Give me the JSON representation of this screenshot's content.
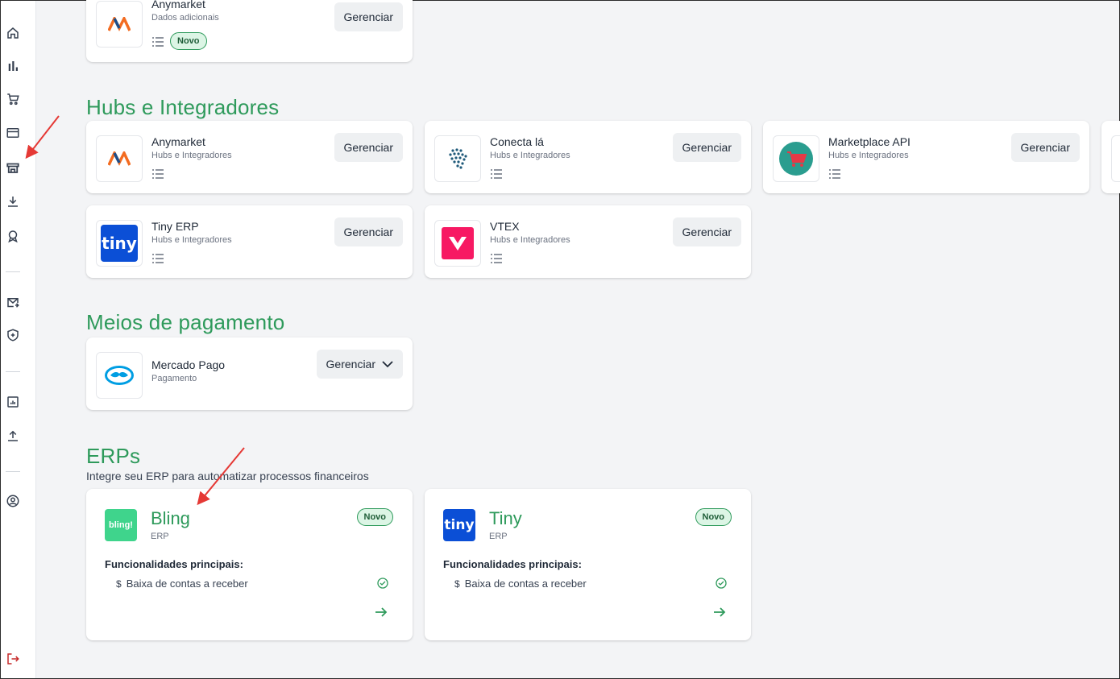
{
  "sidebar": {
    "items": [
      {
        "icon": "home-icon"
      },
      {
        "icon": "bar-chart-icon"
      },
      {
        "icon": "cart-icon"
      },
      {
        "icon": "card-icon"
      },
      {
        "icon": "store-icon"
      },
      {
        "icon": "download-icon"
      },
      {
        "icon": "award-icon"
      },
      {
        "icon": "mail-forward-icon"
      },
      {
        "icon": "shield-plus-icon"
      },
      {
        "icon": "report-icon"
      },
      {
        "icon": "upload-icon"
      },
      {
        "icon": "user-circle-icon"
      },
      {
        "icon": "logout-icon"
      }
    ]
  },
  "top_card": {
    "name": "Anymarket",
    "category": "Dados adicionais",
    "badge": "Novo",
    "button": "Gerenciar"
  },
  "hubs": {
    "title": "Hubs e Integradores",
    "cards": [
      {
        "name": "Anymarket",
        "category": "Hubs e Integradores",
        "button": "Gerenciar"
      },
      {
        "name": "Conecta lá",
        "category": "Hubs e Integradores",
        "button": "Gerenciar"
      },
      {
        "name": "Marketplace API",
        "category": "Hubs e Integradores",
        "button": "Gerenciar"
      },
      {
        "name": "Tiny ERP",
        "category": "Hubs e Integradores",
        "button": "Gerenciar"
      },
      {
        "name": "VTEX",
        "category": "Hubs e Integradores",
        "button": "Gerenciar"
      }
    ]
  },
  "payments": {
    "title": "Meios de pagamento",
    "cards": [
      {
        "name": "Mercado Pago",
        "category": "Pagamento",
        "button": "Gerenciar"
      }
    ]
  },
  "erps": {
    "title": "ERPs",
    "subtitle": "Integre seu ERP para automatizar processos financeiros",
    "cards": [
      {
        "name": "Bling",
        "category": "ERP",
        "badge": "Novo",
        "func_title": "Funcionalidades principais:",
        "feature_symbol": "$",
        "feature": "Baixa de contas a receber",
        "logo_text": "bling!"
      },
      {
        "name": "Tiny",
        "category": "ERP",
        "badge": "Novo",
        "func_title": "Funcionalidades principais:",
        "feature_symbol": "$",
        "feature": "Baixa de contas a receber",
        "logo_text": "tiny"
      }
    ]
  },
  "logos": {
    "tiny_text": "tiny"
  },
  "colors": {
    "accent": "#2e9a5b",
    "badge_bg": "#dcf5e5",
    "logout": "#c62828",
    "annotation": "#e53935"
  }
}
